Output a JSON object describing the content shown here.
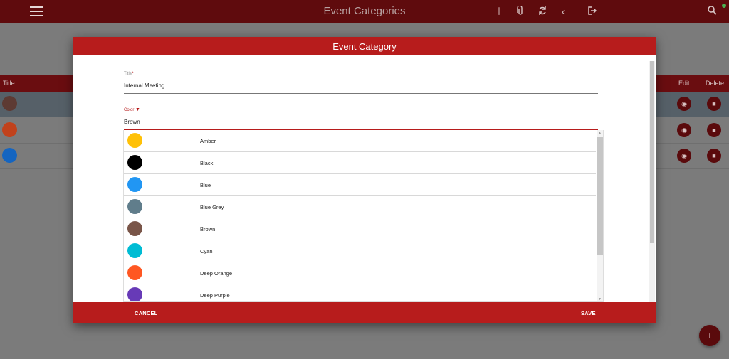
{
  "appbar": {
    "title": "Event Categories",
    "tools": [
      "plus-icon",
      "paperclip-icon",
      "refresh-icon",
      "chevron-left-icon",
      "sign-out-icon",
      "search-icon"
    ]
  },
  "table": {
    "columns": {
      "title": "Title",
      "edit": "Edit",
      "delete": "Delete"
    },
    "rows": [
      {
        "color": "#5d3a33"
      },
      {
        "color": "#c1421c"
      },
      {
        "color": "#1565c0"
      }
    ]
  },
  "dialog": {
    "title": "Event Category",
    "title_field": {
      "label": "Title",
      "required_mark": "*",
      "value": "Internal Meeting"
    },
    "color_field": {
      "label": "Color",
      "value": "Brown"
    },
    "options": [
      {
        "name": "Amber",
        "color": "#ffc107"
      },
      {
        "name": "Black",
        "color": "#000000"
      },
      {
        "name": "Blue",
        "color": "#2196f3"
      },
      {
        "name": "Blue Grey",
        "color": "#607d8b"
      },
      {
        "name": "Brown",
        "color": "#795548"
      },
      {
        "name": "Cyan",
        "color": "#00bcd4"
      },
      {
        "name": "Deep Orange",
        "color": "#ff5722"
      },
      {
        "name": "Deep Purple",
        "color": "#673ab7"
      }
    ],
    "cancel_label": "CANCEL",
    "save_label": "SAVE"
  },
  "fab": {
    "label": "+"
  },
  "colors": {
    "primary": "#b71c1c",
    "appbar_dimmed": "#5f0b0d",
    "status_online": "#4caf50"
  }
}
